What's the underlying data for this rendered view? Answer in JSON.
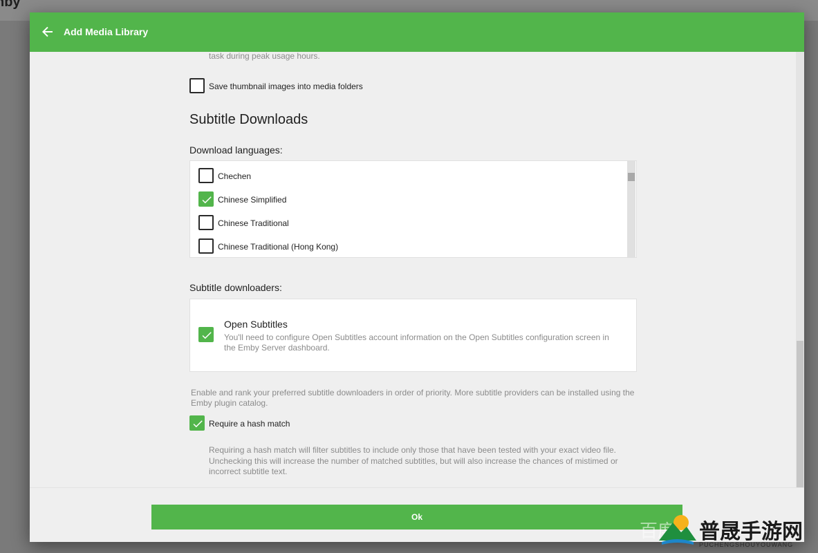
{
  "background": {
    "app_logo_text": "nby"
  },
  "header": {
    "title": "Add Media Library",
    "back_icon": "arrow-left-icon",
    "color": "#52b54b"
  },
  "content": {
    "top_text": "task during peak usage hours.",
    "save_thumbnails": {
      "label": "Save thumbnail images into media folders",
      "checked": false
    },
    "subtitle_heading": "Subtitle Downloads",
    "download_languages_label": "Download languages:",
    "languages": [
      {
        "label": "Chechen",
        "checked": false
      },
      {
        "label": "Chinese Simplified",
        "checked": true
      },
      {
        "label": "Chinese Traditional",
        "checked": false
      },
      {
        "label": "Chinese Traditional (Hong Kong)",
        "checked": false
      }
    ],
    "downloaders_label": "Subtitle downloaders:",
    "downloader": {
      "name": "Open Subtitles",
      "description_line1": "You'll need to configure Open Subtitles account information on the Open Subtitles configuration screen in",
      "description_line2": "the Emby Server dashboard.",
      "checked": true
    },
    "downloaders_help_line1": "Enable and rank your preferred subtitle downloaders in order of priority. More subtitle providers can be installed using the",
    "downloaders_help_line2": "Emby plugin catalog.",
    "hash_match": {
      "label": "Require a hash match",
      "checked": true,
      "help_line1": "Requiring a hash match will filter subtitles to include only those that have been tested with your exact video file.",
      "help_line2": "Unchecking this will increase the number of matched subtitles, but will also increase the chances of mistimed or",
      "help_line3": "incorrect subtitle text."
    }
  },
  "footer": {
    "ok_label": "Ok"
  },
  "watermark": {
    "main_text": "普晟手游网",
    "sub_text": "PUCHENGSHOUYOUWANG",
    "left_text": "百度"
  }
}
